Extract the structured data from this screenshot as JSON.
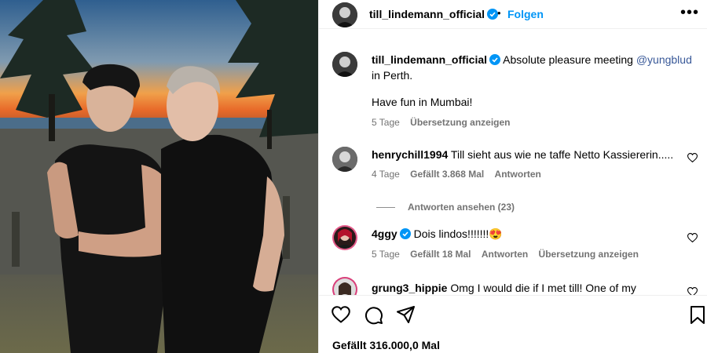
{
  "header": {
    "username": "till_lindemann_official",
    "separator": "•",
    "follow_label": "Folgen",
    "more_label": "•••"
  },
  "caption": {
    "username": "till_lindemann_official",
    "text_before": "Absolute pleasure meeting ",
    "mention": "@yungblud",
    "text_after": " in Perth.",
    "line2": "Have fun in Mumbai!",
    "time": "5 Tage",
    "translate": "Übersetzung anzeigen"
  },
  "comments": [
    {
      "username": "henrychill1994",
      "text": "Till sieht aus wie ne taffe Netto Kassiererin.....",
      "time": "4 Tage",
      "likes": "Gefällt 3.868 Mal",
      "reply": "Antworten",
      "view_replies": "Antworten ansehen (23)"
    },
    {
      "username": "4ggy",
      "verified": true,
      "text": "Dois lindos!!!!!!!",
      "emoji": "😍",
      "time": "5 Tage",
      "likes": "Gefällt 18 Mal",
      "reply": "Antworten",
      "translate": "Übersetzung anzeigen"
    },
    {
      "username": "grung3_hippie",
      "text": "Omg I would die if I met till! One of my"
    }
  ],
  "footer": {
    "likes": "Gefällt 316.000,0 Mal"
  },
  "icons": {
    "verified": "verified-badge-icon",
    "heart": "heart-icon",
    "comment": "comment-icon",
    "share": "paper-plane-icon",
    "save": "bookmark-icon"
  },
  "colors": {
    "link_blue": "#0095f6",
    "mention": "#385898",
    "meta_gray": "#737373",
    "divider": "#efefef"
  }
}
